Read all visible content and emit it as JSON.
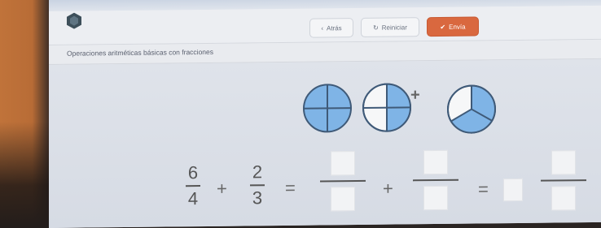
{
  "toolbar": {
    "back_label": "Atrás",
    "reset_label": "Reiniciar",
    "send_label": "Envía",
    "send_color": "#d9683f"
  },
  "activity": {
    "title": "Operaciones aritméticas básicas con fracciones"
  },
  "pies": [
    {
      "parts": 4,
      "shaded": 4
    },
    {
      "parts": 4,
      "shaded": 2
    },
    {
      "parts": 3,
      "shaded": 2
    }
  ],
  "equation": {
    "f1": {
      "num": "6",
      "den": "4"
    },
    "op1": "+",
    "f2": {
      "num": "2",
      "den": "3"
    },
    "eq1": "=",
    "op2": "+",
    "eq2": "=",
    "pie_plus": "+"
  },
  "colors": {
    "pie_fill": "#7fb4e6",
    "pie_empty": "#f6f7f8",
    "pie_stroke": "#3f5a78"
  }
}
